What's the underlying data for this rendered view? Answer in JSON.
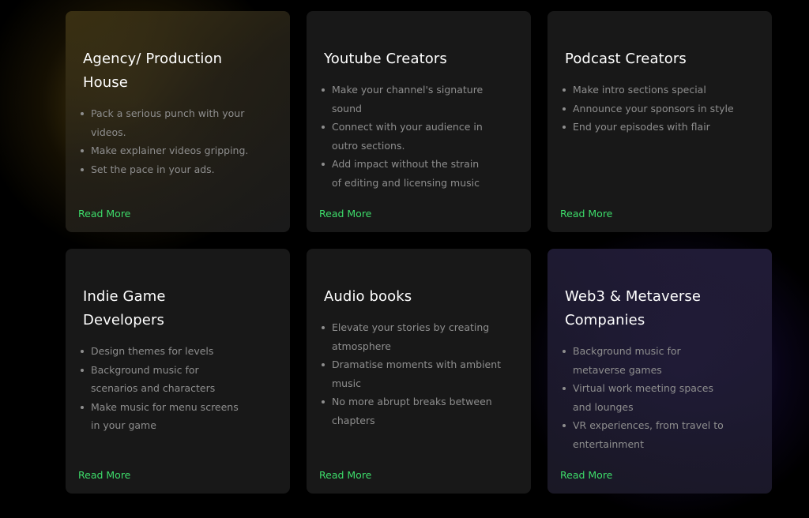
{
  "cards": [
    {
      "title": "Agency/ Production House",
      "bullets": [
        "Pack a serious punch with your videos.",
        "Make explainer videos gripping.",
        "Set the pace in your ads."
      ],
      "link": "Read More"
    },
    {
      "title": "Youtube Creators",
      "bullets": [
        "Make your channel's signature sound",
        "Connect with your audience in outro sections.",
        "Add impact without the strain of editing and licensing music"
      ],
      "link": "Read More"
    },
    {
      "title": "Podcast Creators",
      "bullets": [
        "Make intro sections special",
        "Announce your sponsors in style",
        "End your episodes with flair"
      ],
      "link": "Read More"
    },
    {
      "title": "Indie Game Developers",
      "bullets": [
        "Design themes for levels",
        "Background music for scenarios and characters",
        "Make music for menu screens in your game"
      ],
      "link": "Read More"
    },
    {
      "title": "Audio books",
      "bullets": [
        "Elevate your stories by creating atmosphere",
        "Dramatise moments with ambient music",
        "No more abrupt breaks between chapters"
      ],
      "link": "Read More"
    },
    {
      "title": "Web3 & Metaverse Companies",
      "bullets": [
        "Background music for metaverse games",
        "Virtual work meeting spaces and lounges",
        "VR experiences, from travel to entertainment"
      ],
      "link": "Read More"
    }
  ],
  "colors": {
    "background": "#000000",
    "card": "#1a1a1a",
    "title": "#ffffff",
    "bullet_text": "#8e8e8e",
    "link": "#3ddc6a",
    "glow_gold": "#96781e",
    "glow_violet": "#5032c8"
  }
}
